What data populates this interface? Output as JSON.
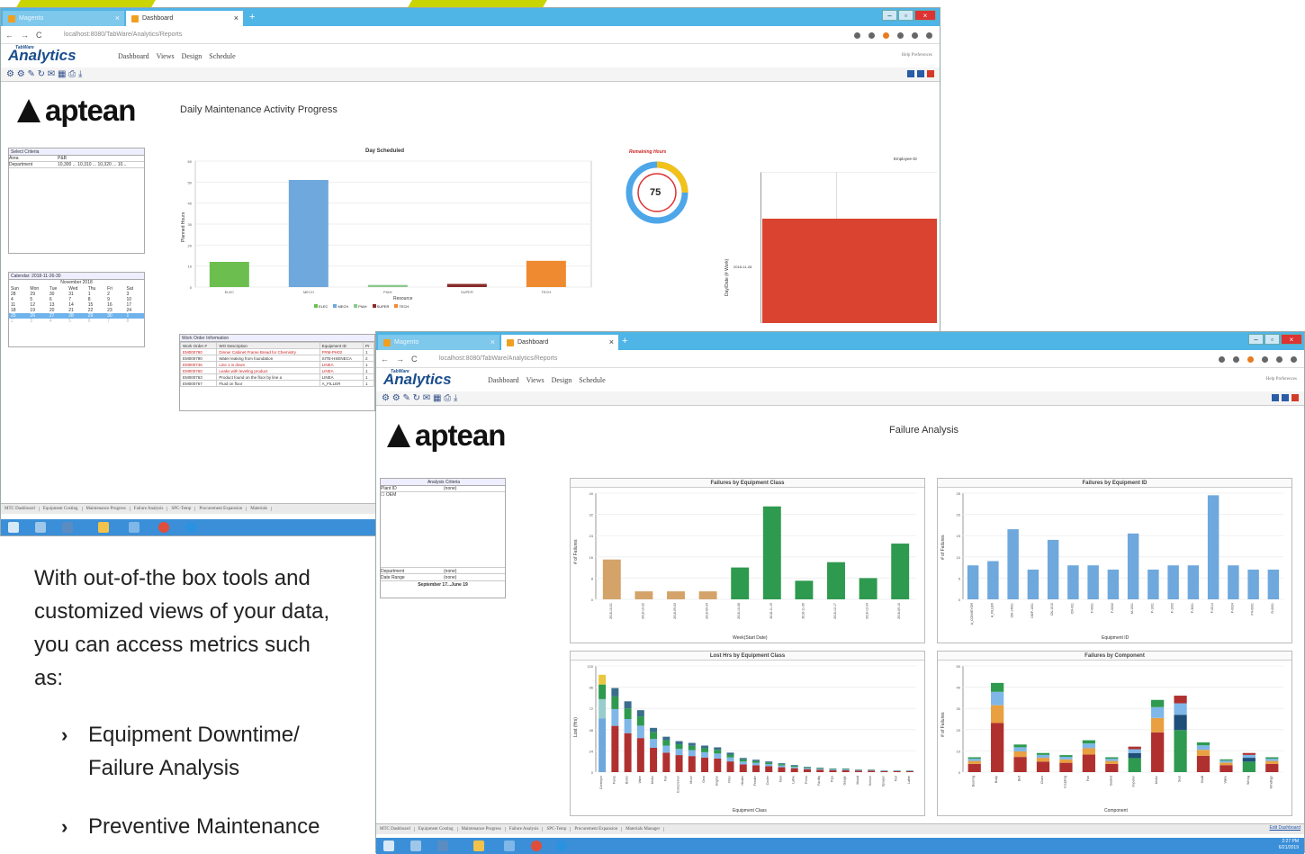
{
  "window1": {
    "tabs": [
      {
        "label": "Magento"
      },
      {
        "label": "Dashboard"
      }
    ],
    "url": "localhost:8080/TabWare/Analytics/Reports",
    "logo": {
      "super": "TabWare",
      "name": "Analytics"
    },
    "menu": [
      "Dashboard",
      "Views",
      "Design",
      "Schedule"
    ],
    "help": "Help  Preferences",
    "toolbar_icons": "⚙ ⚙ ✎ ↻ ✉ ▦ ⎙ ⤓",
    "brand": "aptean",
    "page_title": "Daily Maintenance Activity Progress",
    "criteria": {
      "title": "Select Criteria",
      "rows": [
        [
          "Area",
          "P&B"
        ],
        [
          "Department",
          "10,300 ... 10,310 ... 10,320 ... 10..."
        ]
      ]
    },
    "calendar": {
      "title": "Calendar: 2018-11-26-30",
      "month": "November 2018",
      "days": [
        "Sun",
        "Mon",
        "Tue",
        "Wed",
        "Thu",
        "Fri",
        "Sat"
      ],
      "weeks": [
        [
          "28",
          "29",
          "30",
          "31",
          "1",
          "2",
          "3"
        ],
        [
          "4",
          "5",
          "6",
          "7",
          "8",
          "9",
          "10"
        ],
        [
          "11",
          "12",
          "13",
          "14",
          "15",
          "16",
          "17"
        ],
        [
          "18",
          "19",
          "20",
          "21",
          "22",
          "23",
          "24"
        ],
        [
          "25",
          "26",
          "27",
          "28",
          "29",
          "30",
          "1"
        ],
        [
          "2",
          "3",
          "4",
          "5",
          "6",
          "7",
          "8"
        ]
      ]
    },
    "chart_day": {
      "title": "Day Scheduled",
      "ylabel": "Planned Hours",
      "xlabel": "Resource",
      "legend": [
        "ELEC",
        "MECH",
        "PIAH",
        "SUPER",
        "TECH"
      ]
    },
    "remaining": {
      "title": "Remaining Hours",
      "value": "75"
    },
    "employee": {
      "title": "Employee ID",
      "ylabel": "Day/Date (# Work)",
      "tick": "2018-11-28"
    },
    "work_orders": {
      "title": "Work Order Information",
      "headers": [
        "Work Order #",
        "WO Description",
        "Equipment ID",
        "Pr"
      ],
      "rows": [
        [
          "EM000790",
          "Dinner Cabinet Frame Bread for Chemistry",
          "FRM-PH02",
          "1"
        ],
        [
          "EM000790",
          "Water leaking from foundation",
          "SITE-HSENECA",
          "2"
        ],
        [
          "EM000746",
          "Line 1 is down",
          "LINEA",
          "1"
        ],
        [
          "EM000760",
          "Leaks with leveling product",
          "LINEA",
          "1"
        ],
        [
          "EM000763",
          "Product found on the floor by line a",
          "LINEA",
          "1"
        ],
        [
          "EM000767",
          "Fluid on floor",
          "A_FILLER",
          "1"
        ]
      ]
    },
    "bottom_tabs": [
      "MTC Dashboard",
      "Equipment Costing",
      "Maintenance Progress",
      "Failure Analysis",
      "SPC-Temp",
      "Procurement Expansion",
      "Materials"
    ]
  },
  "window2": {
    "tabs": [
      {
        "label": "Magento"
      },
      {
        "label": "Dashboard"
      }
    ],
    "url": "localhost:8080/TabWare/Analytics/Reports",
    "logo": {
      "super": "TabWare",
      "name": "Analytics"
    },
    "menu": [
      "Dashboard",
      "Views",
      "Design",
      "Schedule"
    ],
    "help": "Help  Preferences",
    "toolbar_icons": "⚙ ⚙ ✎ ↻ ✉ ▦ ⎙ ⤓",
    "brand": "aptean",
    "page_title": "Failure Analysis",
    "criteria": {
      "title": "Analysis Criteria",
      "rows": [
        [
          "Plant ID",
          "(none)"
        ],
        [
          "OEM",
          ""
        ]
      ],
      "rows2": [
        [
          "Department",
          "(none)"
        ],
        [
          "Date Range",
          "(none)"
        ]
      ],
      "range": "September 17...June 19"
    },
    "bottom_tabs": [
      "MTC Dashboard",
      "Equipment Costing",
      "Maintenance Progress",
      "Failure Analysis",
      "SPC-Temp",
      "Procurement Expansion",
      "Materials Manager"
    ],
    "edit_link": "Edit Dashboard",
    "clock": {
      "time": "2:27 PM",
      "date": "6/21/2019"
    }
  },
  "description": "With out-of-the box tools and customized views of your data, you can access metrics such as:",
  "bullets": [
    "Equipment Downtime/ Failure Analysis",
    "Preventive Maintenance"
  ],
  "colors": {
    "accent_yellow": "#c9d400",
    "tab_blue": "#4fb4e6",
    "bar_blue": "#6fa8dc",
    "bar_green": "#2e9a4f",
    "bar_red": "#b03030"
  },
  "chart_data": [
    {
      "type": "bar",
      "title": "Day Scheduled",
      "xlabel": "Resource",
      "ylabel": "Planned Hours",
      "categories": [
        "ELEC",
        "MECH",
        "PIAH",
        "SUPER",
        "TECH"
      ],
      "values": [
        12,
        51,
        1,
        1.5,
        12.5
      ],
      "ylim": [
        0,
        60
      ]
    },
    {
      "type": "bar",
      "title": "Failures by Equipment Class",
      "xlabel": "Week(Start Date)",
      "ylabel": "# of Failures",
      "categories": [
        "2018-10-01",
        "2018-10-22",
        "2018-09-03",
        "2018-09-24",
        "2018-10-08",
        "2018-11-19",
        "2018-11-26",
        "2018-12-17",
        "2018-12-24",
        "2018-09-10"
      ],
      "values": [
        15,
        3,
        3,
        3,
        12,
        35,
        7,
        14,
        8,
        21
      ],
      "ylim": [
        0,
        40
      ]
    },
    {
      "type": "bar",
      "title": "Failures by Equipment ID",
      "xlabel": "Equipment ID",
      "ylabel": "# of Failures",
      "categories": [
        "A_CONVEYOR",
        "A_FILLER",
        "CM-14001",
        "CMP-1001",
        "CN-1010",
        "CR-001",
        "F-0001",
        "F-0002",
        "M-1001",
        "P-1001",
        "P-1002",
        "P-3001",
        "P-0014",
        "P-0024",
        "PV-0001",
        "R-0001"
      ],
      "values": [
        8,
        9,
        16.5,
        7,
        14,
        8,
        8,
        7,
        15.5,
        7,
        8,
        8,
        24.5,
        8,
        7,
        7
      ],
      "ylim": [
        0,
        25
      ]
    },
    {
      "type": "bar",
      "title": "Lost Hrs by Equipment Class",
      "xlabel": "Equipment Class",
      "ylabel": "Lost (Hrs)",
      "categories": [
        "Conveyor",
        "Pump",
        "Boiler",
        "Valve",
        "Motor",
        "Fan",
        "Compressor",
        "Mixer",
        "Gear",
        "Engine",
        "Filler",
        "Heater",
        "Feeder",
        "Cooler",
        "Tank",
        "Lathe",
        "Press",
        "Facility",
        "Pipe",
        "Gauge",
        "Mould",
        "Sensor",
        "Sprayer",
        "Tool",
        "Lathe"
      ],
      "values": [
        110,
        95,
        80,
        70,
        50,
        40,
        35,
        33,
        30,
        28,
        22,
        16,
        14,
        12,
        10,
        8,
        6,
        5,
        4,
        4,
        3,
        3,
        2,
        2,
        2
      ],
      "ylim": [
        0,
        120
      ]
    },
    {
      "type": "bar",
      "title": "Failures by Component",
      "xlabel": "Component",
      "ylabel": "# of Failures",
      "categories": [
        "Bearing",
        "Body",
        "Belt",
        "Chain",
        "Coupling",
        "Fan",
        "Gasket",
        "Impeller",
        "Motor",
        "Seal",
        "Shaft",
        "Valve",
        "Wiring",
        "Windings"
      ],
      "values": [
        7,
        42,
        13,
        9,
        8,
        15,
        7,
        12,
        34,
        36,
        14,
        6,
        9,
        7
      ],
      "ylim": [
        0,
        50
      ]
    }
  ]
}
